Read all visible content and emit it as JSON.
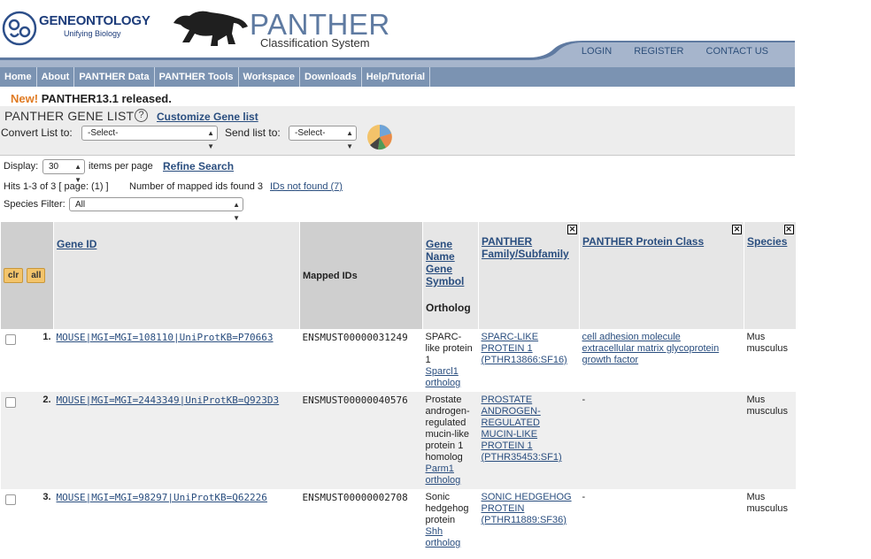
{
  "header": {
    "go_name": "GENEONTOLOGY",
    "go_tagline": "Unifying Biology",
    "panther_title": "PANTHER",
    "panther_subtitle": "Classification System",
    "top_links": [
      "LOGIN",
      "REGISTER",
      "CONTACT US"
    ]
  },
  "nav": [
    "Home",
    "About",
    "PANTHER Data",
    "PANTHER Tools",
    "Workspace",
    "Downloads",
    "Help/Tutorial"
  ],
  "news": {
    "badge": "New!",
    "text": "PANTHER13.1 released."
  },
  "gene_list": {
    "title": "PANTHER GENE LIST",
    "help": "?",
    "customize": "Customize Gene list",
    "convert_label": "Convert List to:",
    "convert_value": "-Select-",
    "send_label": "Send list to:",
    "send_value": "-Select-"
  },
  "controls": {
    "display_label": "Display:",
    "display_value": "30",
    "per_page": "items per page",
    "refine": "Refine Search",
    "hits": "Hits 1-3 of 3 [ page: (1) ]",
    "mapped": "Number of mapped ids found 3",
    "not_found": "IDs not found (7)",
    "species_label": "Species Filter:",
    "species_value": "All"
  },
  "table": {
    "btn_clr": "clr",
    "btn_all": "all",
    "h_gene_id": "Gene ID",
    "h_mapped": "Mapped IDs",
    "h_gene_name": "Gene Name",
    "h_gene_symbol": "Gene Symbol",
    "h_ortholog": "Ortholog",
    "h_family": "PANTHER Family/Subfamily",
    "h_class": "PANTHER Protein Class",
    "h_species": "Species",
    "close": "✕",
    "rows": [
      {
        "num": "1.",
        "gene_id": "MOUSE|MGI=MGI=108110|UniProtKB=P70663",
        "mapped": "ENSMUST00000031249",
        "name": "SPARC-like protein 1",
        "symbol": "Sparcl1",
        "ortholog": "ortholog",
        "family": "SPARC-LIKE PROTEIN 1 (PTHR13866:SF16)",
        "classes": [
          "cell adhesion molecule",
          "extracellular matrix glycoprotein",
          "growth factor"
        ],
        "species": "Mus musculus"
      },
      {
        "num": "2.",
        "gene_id": "MOUSE|MGI=MGI=2443349|UniProtKB=Q923D3",
        "mapped": "ENSMUST00000040576",
        "name": "Prostate androgen-regulated mucin-like protein 1 homolog",
        "symbol": "Parm1",
        "ortholog": "ortholog",
        "family": "PROSTATE ANDROGEN-REGULATED MUCIN-LIKE PROTEIN 1 (PTHR35453:SF1)",
        "class_text": "-",
        "species": "Mus musculus"
      },
      {
        "num": "3.",
        "gene_id": "MOUSE|MGI=MGI=98297|UniProtKB=Q62226",
        "mapped": "ENSMUST00000002708",
        "name": "Sonic hedgehog protein",
        "symbol": "Shh",
        "ortholog": "ortholog",
        "family": "SONIC HEDGEHOG PROTEIN (PTHR11889:SF36)",
        "class_text": "-",
        "species": "Mus musculus"
      }
    ]
  }
}
